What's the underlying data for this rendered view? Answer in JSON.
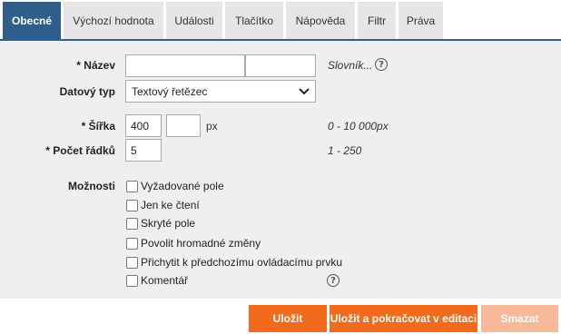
{
  "tabs": [
    {
      "label": "Obecné",
      "active": true
    },
    {
      "label": "Výchozí hodnota",
      "active": false
    },
    {
      "label": "Události",
      "active": false
    },
    {
      "label": "Tlačítko",
      "active": false
    },
    {
      "label": "Nápověda",
      "active": false
    },
    {
      "label": "Filtr",
      "active": false
    },
    {
      "label": "Práva",
      "active": false
    }
  ],
  "form": {
    "name": {
      "label": "* Název",
      "value1": "",
      "value2": "",
      "dictionary_link": "Slovník..."
    },
    "data_type": {
      "label": "Datový typ",
      "selected": "Textový řetězec"
    },
    "width": {
      "label": "* Šířka",
      "value": "400",
      "value2": "",
      "unit": "px",
      "hint": "0 - 10 000px"
    },
    "rows": {
      "label": "* Počet řádků",
      "value": "5",
      "hint": "1 - 250"
    },
    "options": {
      "label": "Možnosti",
      "items": [
        {
          "label": "Vyžadované pole",
          "checked": false
        },
        {
          "label": "Jen ke čtení",
          "checked": false
        },
        {
          "label": "Skryté pole",
          "checked": false
        },
        {
          "label": "Povolit hromadné změny",
          "checked": false
        },
        {
          "label": "Přichytit k předchozímu ovládacímu prvku",
          "checked": false
        },
        {
          "label": "Komentář",
          "checked": false
        }
      ]
    },
    "help_glyph": "?"
  },
  "buttons": {
    "save": "Uložit",
    "save_continue": "Uložit a pokračovat v editaci",
    "delete": "Smazat"
  },
  "colors": {
    "tab_active": "#2f5d8c",
    "button_primary": "#f26a1b",
    "button_disabled": "#f7b99a"
  },
  "icons": {
    "help": "help-circle-icon",
    "dropdown": "chevron-down-icon"
  }
}
